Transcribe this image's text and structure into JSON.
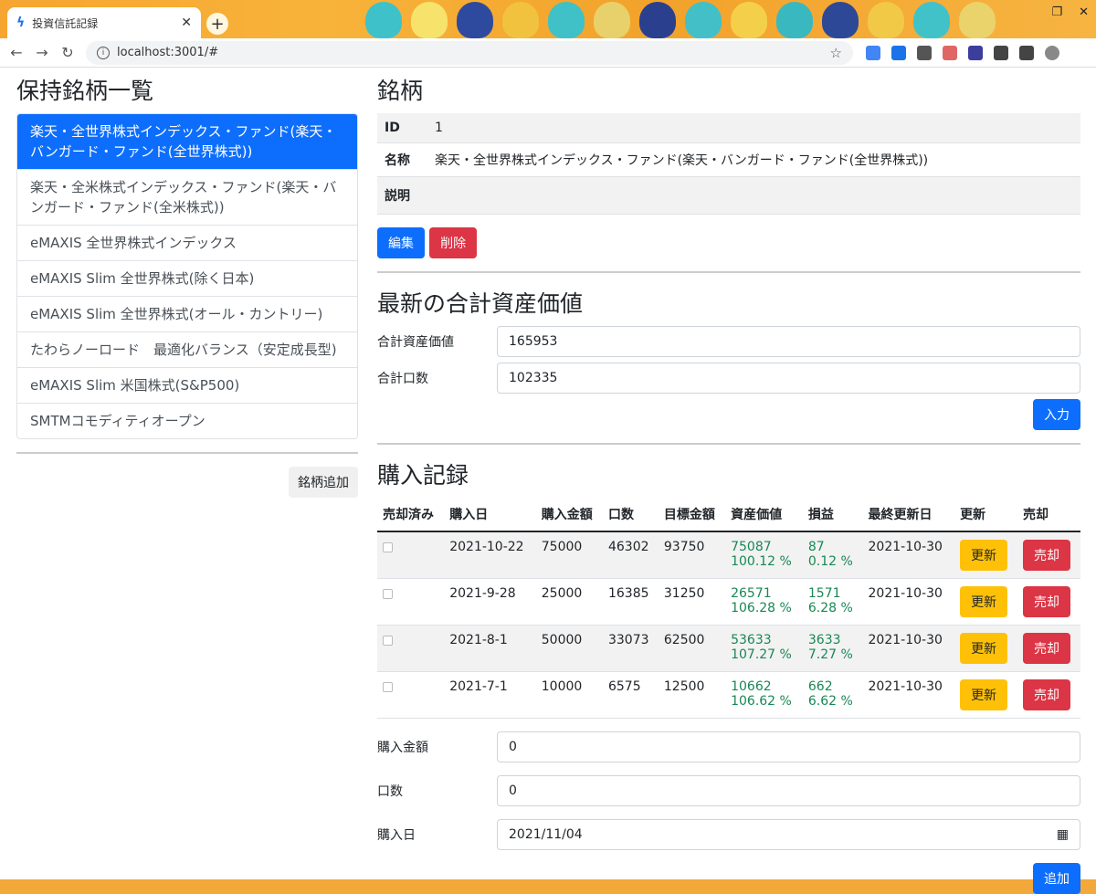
{
  "browser": {
    "tab_title": "投資信託記録",
    "url": "localhost:3001/#"
  },
  "left": {
    "heading": "保持銘柄一覧",
    "items": [
      "楽天・全世界株式インデックス・ファンド(楽天・バンガード・ファンド(全世界株式))",
      "楽天・全米株式インデックス・ファンド(楽天・バンガード・ファンド(全米株式))",
      "eMAXIS 全世界株式インデックス",
      "eMAXIS Slim 全世界株式(除く日本)",
      "eMAXIS Slim 全世界株式(オール・カントリー)",
      "たわらノーロード　最適化バランス（安定成長型)",
      "eMAXIS Slim 米国株式(S&P500)",
      "SMTMコモディティオープン"
    ],
    "add_button": "銘柄追加"
  },
  "fund": {
    "heading": "銘柄",
    "id_label": "ID",
    "id_value": "1",
    "name_label": "名称",
    "name_value": "楽天・全世界株式インデックス・ファンド(楽天・バンガード・ファンド(全世界株式))",
    "desc_label": "説明",
    "desc_value": "",
    "edit_button": "編集",
    "delete_button": "削除"
  },
  "total": {
    "heading": "最新の合計資産価値",
    "value_label": "合計資産価値",
    "value": "165953",
    "units_label": "合計口数",
    "units": "102335",
    "submit": "入力"
  },
  "purchases": {
    "heading": "購入記録",
    "columns": [
      "売却済み",
      "購入日",
      "購入金額",
      "口数",
      "目標金額",
      "資産価値",
      "損益",
      "最終更新日",
      "更新",
      "売却"
    ],
    "rows": [
      {
        "date": "2021-10-22",
        "amount": "75000",
        "units": "46302",
        "target": "93750",
        "value": "75087",
        "value_pct": "100.12 %",
        "pl": "87",
        "pl_pct": "0.12 %",
        "updated": "2021-10-30"
      },
      {
        "date": "2021-9-28",
        "amount": "25000",
        "units": "16385",
        "target": "31250",
        "value": "26571",
        "value_pct": "106.28 %",
        "pl": "1571",
        "pl_pct": "6.28 %",
        "updated": "2021-10-30"
      },
      {
        "date": "2021-8-1",
        "amount": "50000",
        "units": "33073",
        "target": "62500",
        "value": "53633",
        "value_pct": "107.27 %",
        "pl": "3633",
        "pl_pct": "7.27 %",
        "updated": "2021-10-30"
      },
      {
        "date": "2021-7-1",
        "amount": "10000",
        "units": "6575",
        "target": "12500",
        "value": "10662",
        "value_pct": "106.62 %",
        "pl": "662",
        "pl_pct": "6.62 %",
        "updated": "2021-10-30"
      }
    ],
    "update_button": "更新",
    "sell_button": "売却"
  },
  "new_purchase": {
    "amount_label": "購入金額",
    "amount": "0",
    "units_label": "口数",
    "units": "0",
    "date_label": "購入日",
    "date": "2021/11/04",
    "add_button": "追加"
  }
}
